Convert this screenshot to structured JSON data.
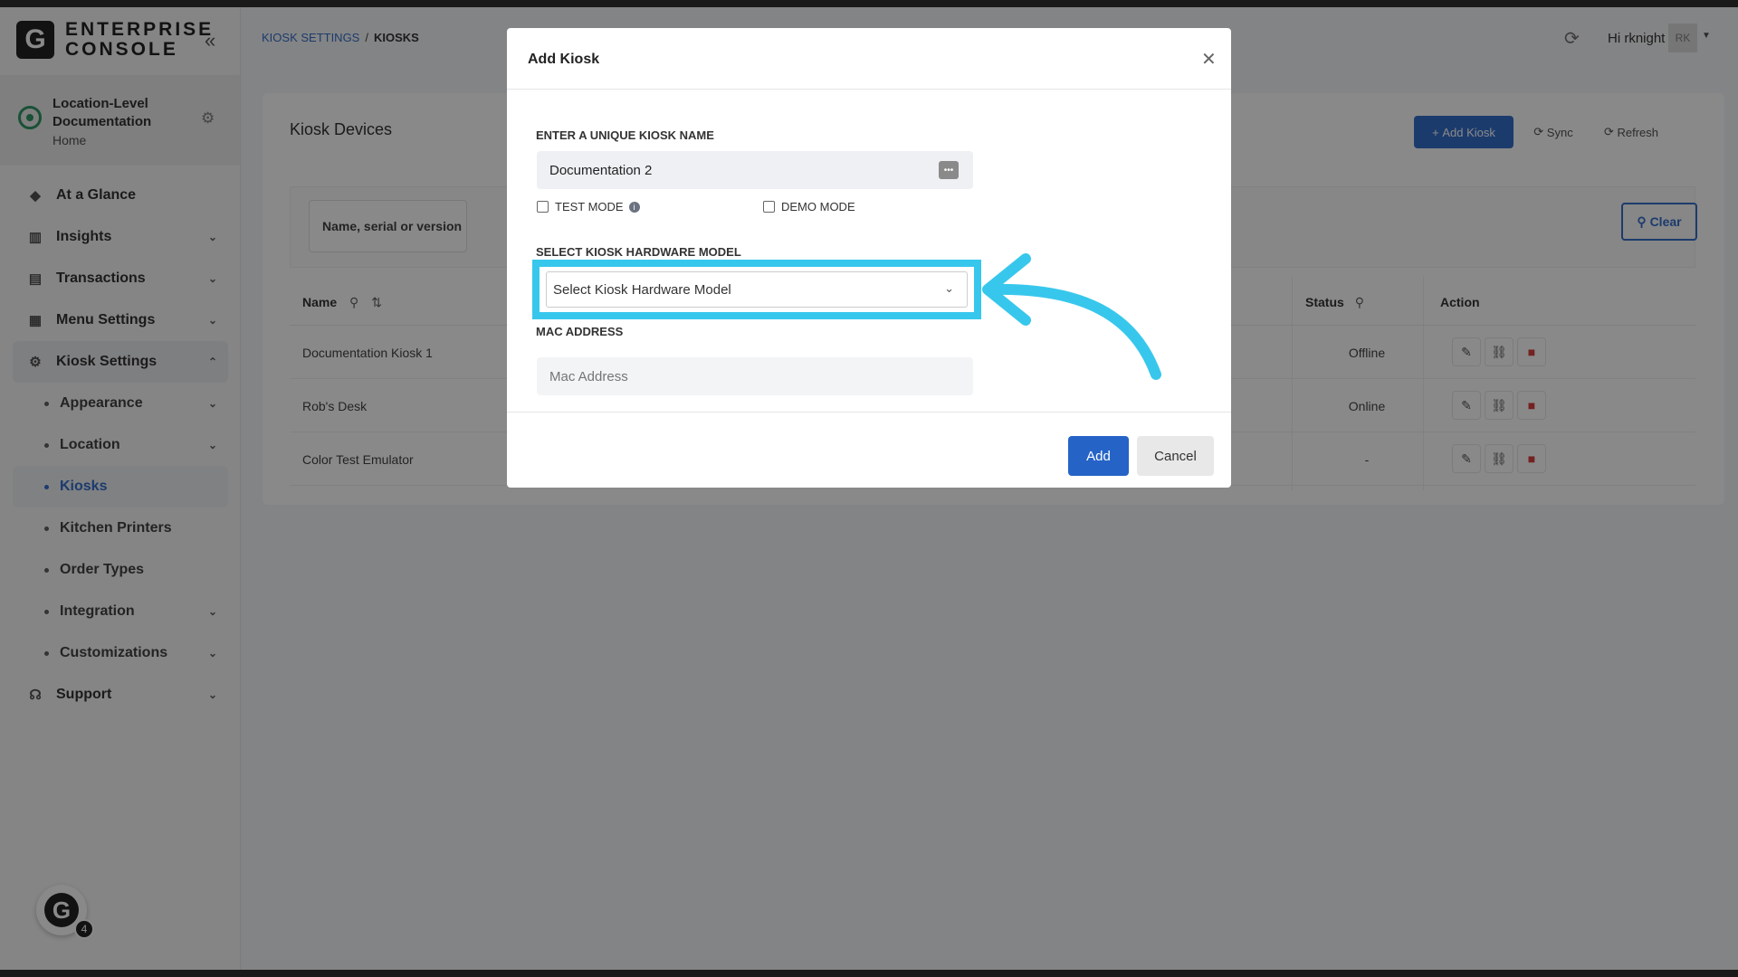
{
  "brand": {
    "logo_letter": "G",
    "line1": "ENTERPRISE",
    "line2": "CONSOLE"
  },
  "location": {
    "title": "Location-Level Documentation",
    "subtitle": "Home"
  },
  "nav": {
    "at_a_glance": "At a Glance",
    "insights": "Insights",
    "transactions": "Transactions",
    "menu_settings": "Menu Settings",
    "kiosk_settings": "Kiosk Settings",
    "sub": {
      "appearance": "Appearance",
      "location": "Location",
      "kiosks": "Kiosks",
      "kitchen_printers": "Kitchen Printers",
      "order_types": "Order Types",
      "integration": "Integration",
      "customizations": "Customizations"
    },
    "support": "Support"
  },
  "breadcrumb": {
    "parent": "KIOSK SETTINGS",
    "separator": "/",
    "current": "KIOSKS"
  },
  "user": {
    "greeting": "Hi rknight",
    "initials": "RK"
  },
  "page": {
    "title": "Kiosk Devices",
    "add_kiosk_label": "Add Kiosk",
    "sync_label": "Sync",
    "refresh_label": "Refresh",
    "search_placeholder": "Name, serial or version",
    "clear_label": "Clear"
  },
  "table": {
    "headers": {
      "name": "Name",
      "status": "Status",
      "action": "Action"
    },
    "rows": [
      {
        "name": "Documentation Kiosk 1",
        "status": "Offline"
      },
      {
        "name": "Rob's Desk",
        "status": "Online"
      },
      {
        "name": "Color Test Emulator",
        "status": "-"
      }
    ]
  },
  "modal": {
    "title": "Add Kiosk",
    "name_label": "ENTER A UNIQUE KIOSK NAME",
    "name_value": "Documentation 2",
    "test_mode_label": "TEST MODE",
    "demo_mode_label": "DEMO MODE",
    "hardware_label": "SELECT KIOSK HARDWARE MODEL",
    "hardware_placeholder": "Select Kiosk Hardware Model",
    "mac_label": "MAC ADDRESS",
    "mac_placeholder": "Mac Address",
    "add_label": "Add",
    "cancel_label": "Cancel"
  },
  "assistant": {
    "letter": "G",
    "badge": "4"
  },
  "colors": {
    "accent": "#2563c7",
    "highlight": "#38c7ec",
    "delete": "#d32f2f",
    "location_pin": "#1e8e5a"
  }
}
